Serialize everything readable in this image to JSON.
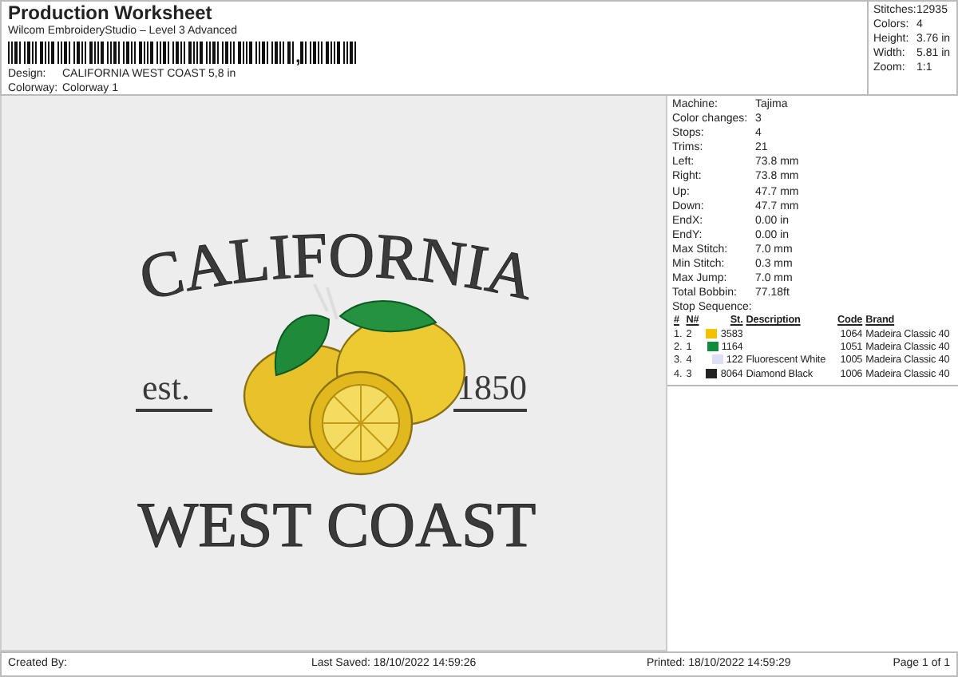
{
  "header": {
    "title": "Production Worksheet",
    "subtitle": "Wilcom EmbroideryStudio – Level 3 Advanced",
    "barcode_mark": ",",
    "fields": [
      {
        "label": "Design:",
        "value": "CALIFORNIA WEST COAST 5,8 in"
      },
      {
        "label": "Colorway:",
        "value": "Colorway 1"
      }
    ]
  },
  "summary": [
    {
      "label": "Stitches:",
      "value": "12935"
    },
    {
      "label": "Colors:",
      "value": "4"
    },
    {
      "label": "Height:",
      "value": "3.76 in"
    },
    {
      "label": "Width:",
      "value": "5.81 in"
    },
    {
      "label": "Zoom:",
      "value": "1:1"
    }
  ],
  "design": {
    "arch_text": "CALIFORNIA",
    "left_text": "est.",
    "right_text": "1850",
    "bottom_text": "WEST COAST"
  },
  "details": [
    {
      "label": "Machine:",
      "value": "Tajima"
    },
    {
      "label": "Color changes:",
      "value": "3"
    },
    {
      "label": "Stops:",
      "value": "4"
    },
    {
      "label": "Trims:",
      "value": "21"
    },
    {
      "label": "Left:",
      "value": "73.8 mm"
    },
    {
      "label": "Right:",
      "value": "73.8 mm"
    },
    {
      "label": "Up:",
      "value": "47.7 mm"
    },
    {
      "label": "Down:",
      "value": "47.7 mm"
    },
    {
      "label": "EndX:",
      "value": "0.00 in"
    },
    {
      "label": "EndY:",
      "value": "0.00 in"
    },
    {
      "label": "Max Stitch:",
      "value": "7.0 mm"
    },
    {
      "label": "Min Stitch:",
      "value": "0.3 mm"
    },
    {
      "label": "Max Jump:",
      "value": "7.0 mm"
    },
    {
      "label": "Total Bobbin:",
      "value": "77.18ft"
    }
  ],
  "stop_sequence": {
    "title": "Stop Sequence:",
    "columns": [
      "#",
      "N#",
      "St.",
      "Description",
      "Code",
      "Brand"
    ],
    "rows": [
      {
        "index": "1.",
        "n": "2",
        "color": "#f2c200",
        "st": "3583",
        "description": "",
        "code": "1064",
        "brand": "Madeira Classic 40"
      },
      {
        "index": "2.",
        "n": "1",
        "color": "#138a3c",
        "st": "1164",
        "description": "",
        "code": "1051",
        "brand": "Madeira Classic 40"
      },
      {
        "index": "3.",
        "n": "4",
        "color": "#dcdff5",
        "st": "122",
        "description": "Fluorescent White",
        "code": "1005",
        "brand": "Madeira Classic 40"
      },
      {
        "index": "4.",
        "n": "3",
        "color": "#222222",
        "st": "8064",
        "description": "Diamond Black",
        "code": "1006",
        "brand": "Madeira Classic 40"
      }
    ]
  },
  "footer": {
    "created_by": "Created By:",
    "last_saved": "Last Saved: 18/10/2022 14:59:26",
    "printed": "Printed: 18/10/2022 14:59:29",
    "page": "Page 1 of 1"
  }
}
